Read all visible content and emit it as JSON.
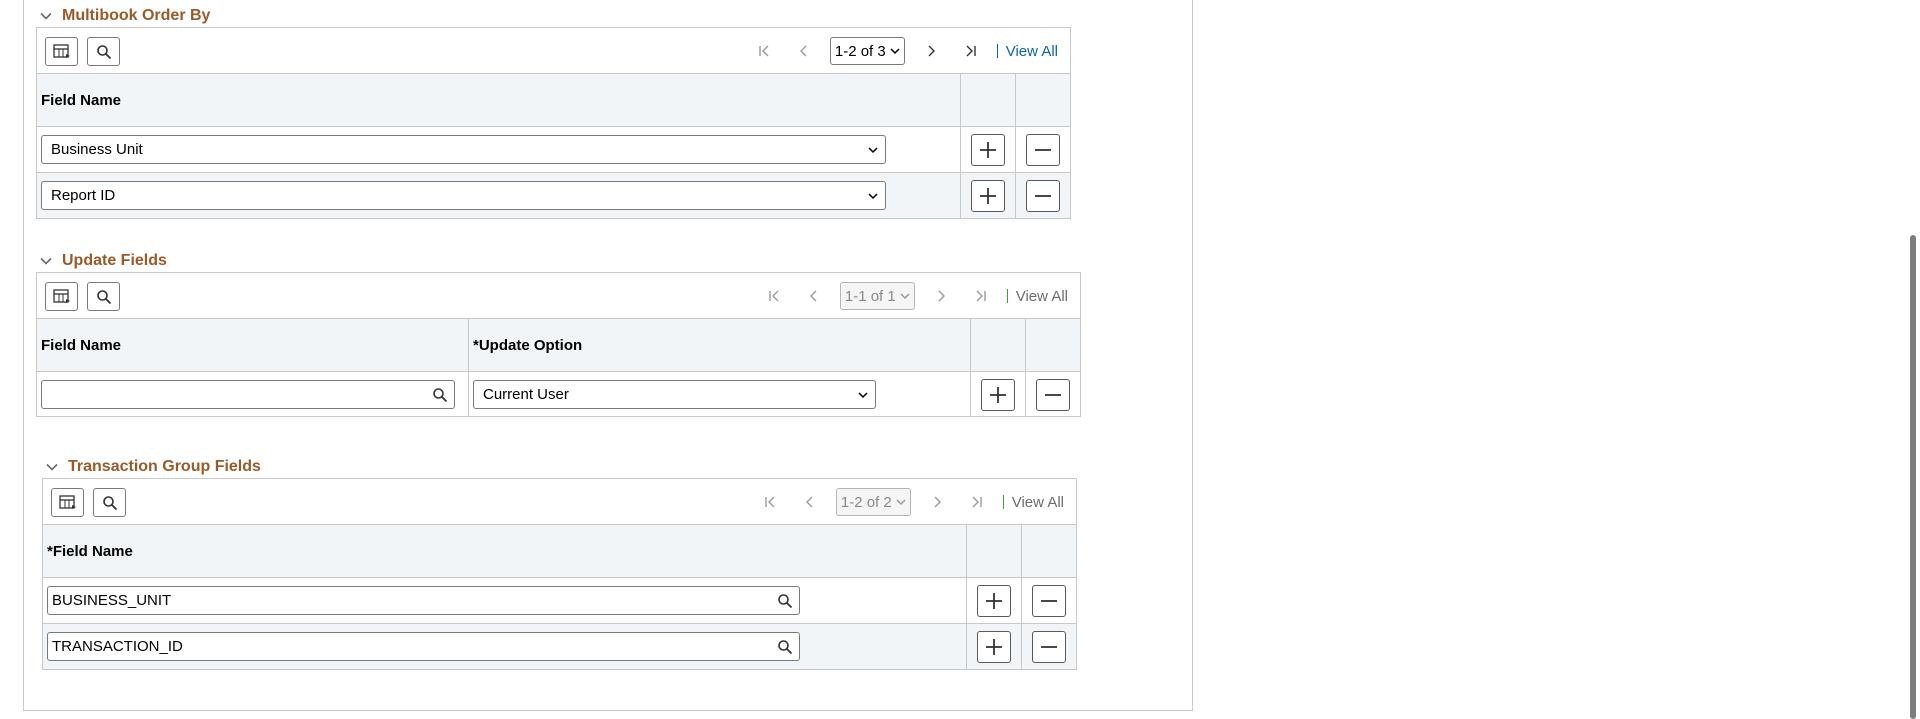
{
  "multibook": {
    "title": "Multibook Order By",
    "pager": "1-2 of 3",
    "view_all": "View All",
    "columns": {
      "field_name": "Field Name"
    },
    "rows": [
      {
        "field": "Business Unit"
      },
      {
        "field": "Report ID"
      }
    ]
  },
  "update_fields": {
    "title": "Update Fields",
    "pager": "1-1 of 1",
    "view_all": "View All",
    "columns": {
      "field_name": "Field Name",
      "update_option": "*Update Option"
    },
    "rows": [
      {
        "field": "",
        "option": "Current User"
      }
    ]
  },
  "transaction_group": {
    "title": "Transaction Group Fields",
    "pager": "1-2 of 2",
    "view_all": "View All",
    "columns": {
      "field_name": "*Field Name"
    },
    "rows": [
      {
        "field": "BUSINESS_UNIT"
      },
      {
        "field": "TRANSACTION_ID"
      }
    ]
  },
  "icons": {
    "collapse": "chevron-down-icon",
    "personalize": "grid-personalize-icon",
    "find": "search-icon",
    "first": "first-page-icon",
    "prev": "previous-page-icon",
    "next": "next-page-icon",
    "last": "last-page-icon",
    "add": "plus-icon",
    "delete": "minus-icon",
    "lookup": "lookup-icon"
  },
  "colors": {
    "section_title": "#9c5a28",
    "link": "#0a63b2",
    "header_bg": "#f2f5f7",
    "separator_active": "#0a63b2",
    "separator_disabled": "#3e9e3e"
  }
}
